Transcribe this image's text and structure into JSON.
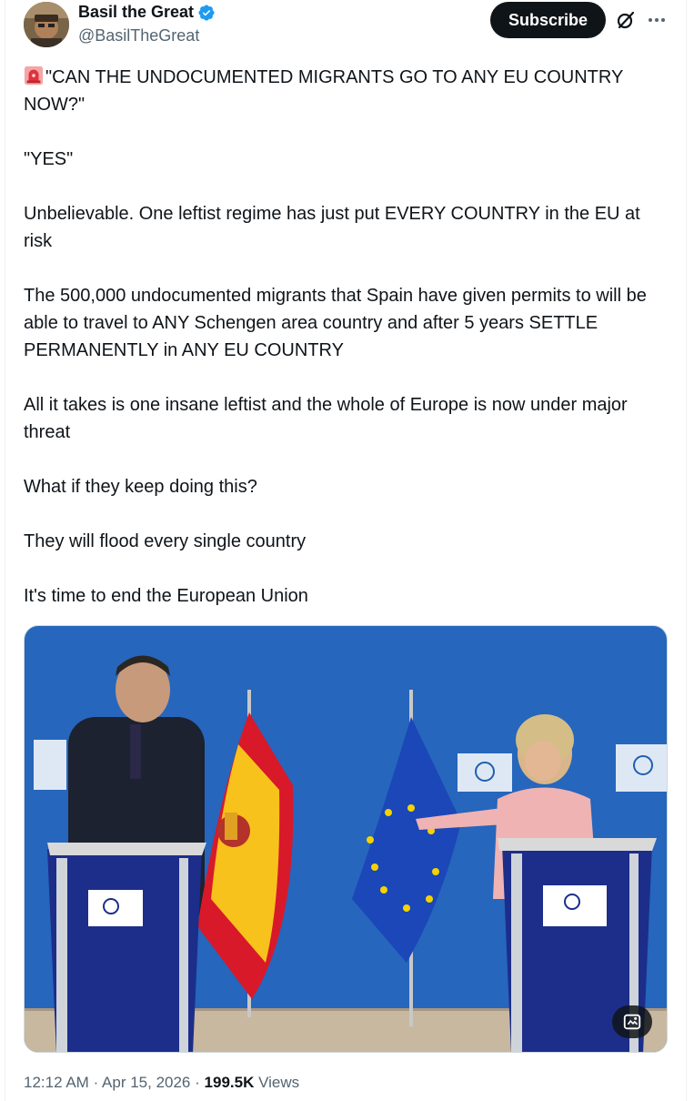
{
  "author": {
    "name": "Basil the Great",
    "handle": "@BasilTheGreat",
    "avatar_icon": "avatar-photo",
    "verified": true,
    "verified_color": "#1d9bf0"
  },
  "actions": {
    "subscribe_label": "Subscribe",
    "grok_icon": "grok-icon",
    "more_icon": "more-icon"
  },
  "post": {
    "paragraphs": [
      "\"CAN THE UNDOCUMENTED MIGRANTS GO TO ANY EU COUNTRY NOW?\"",
      "\"YES\"",
      "Unbelievable. One leftist regime has just put EVERY COUNTRY in the EU at risk",
      "The 500,000 undocumented migrants that Spain have given permits to will be able to travel to ANY Schengen area country and after 5 years SETTLE PERMANENTLY in ANY EU COUNTRY",
      "All it takes is one insane leftist and the whole of Europe is now under major threat",
      "What if they keep doing this?",
      "They will flood every single country",
      "It's time to end the European Union"
    ],
    "leading_emoji": "siren-emoji"
  },
  "media": {
    "description_icon": "image-alt-icon"
  },
  "meta": {
    "time": "12:12 AM",
    "date": "Apr 15, 2026",
    "views_count": "199.5K",
    "views_label": "Views",
    "separator": "·"
  },
  "colors": {
    "text": "#0f1419",
    "secondary": "#536471",
    "button_bg": "#0f1419",
    "eu_blue": "#1f5fb0"
  }
}
